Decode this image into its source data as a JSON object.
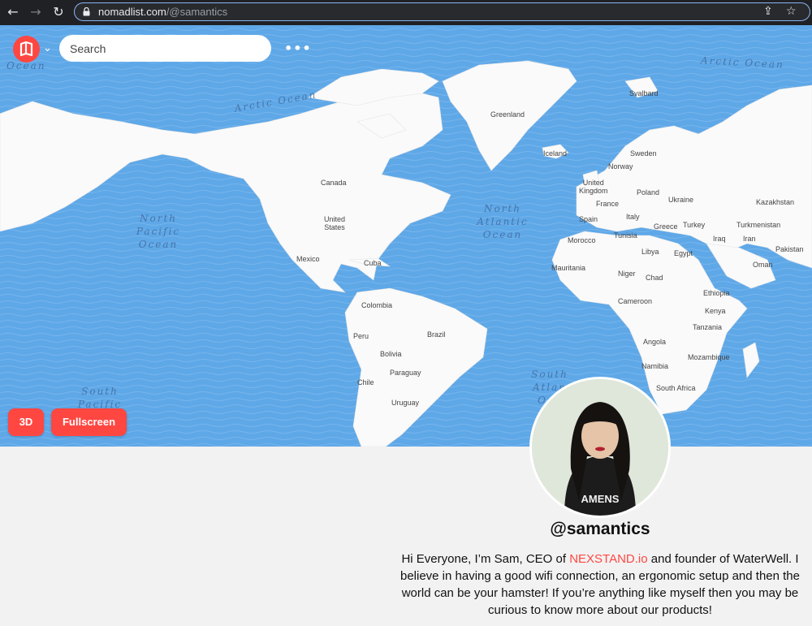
{
  "browser": {
    "url_host": "nomadlist.com",
    "url_path": "/@samantics",
    "icons": [
      "back-arrow-icon",
      "forward-arrow-icon",
      "reload-icon",
      "lock-icon",
      "share-icon",
      "star-icon"
    ]
  },
  "header": {
    "logo_icon": "nomad-list-logo",
    "search_placeholder": "Search",
    "more_icon": "more-dots-icon"
  },
  "map": {
    "oceans": {
      "arctic_left": "Arctic Ocean",
      "arctic_right": "Arctic Ocean",
      "arctic_top_left": "Ocean",
      "north_pacific": [
        "North",
        "Pacific",
        "Ocean"
      ],
      "north_atlantic": [
        "North",
        "Atlantic",
        "Ocean"
      ],
      "south_pacific": [
        "South",
        "Pacific"
      ],
      "south_atlantic": [
        "South",
        "Atlan",
        "Oce"
      ]
    },
    "countries": {
      "svalbard": "Svalbard",
      "greenland": "Greenland",
      "iceland": "Iceland",
      "sweden": "Sweden",
      "norway": "Norway",
      "uk": [
        "United",
        "Kingdom"
      ],
      "poland": "Poland",
      "france": "France",
      "ukraine": "Ukraine",
      "kazakhstan": "Kazakhstan",
      "canada": "Canada",
      "usa": [
        "United",
        "States"
      ],
      "spain": "Spain",
      "italy": "Italy",
      "turkey": "Turkey",
      "turkmenistan": "Turkmenistan",
      "morocco": "Morocco",
      "tunisia": "Tunisia",
      "iraq": "Iraq",
      "iran": "Iran",
      "greece": "Greece",
      "libya": "Libya",
      "egypt": "Egypt",
      "pakistan": "Pakistan",
      "mexico": "Mexico",
      "cuba": "Cuba",
      "oman": "Oman",
      "mauritania": "Mauritania",
      "niger": "Niger",
      "chad": "Chad",
      "ethiopia": "Ethiopia",
      "cameroon": "Cameroon",
      "kenya": "Kenya",
      "colombia": "Colombia",
      "tanzania": "Tanzania",
      "peru": "Peru",
      "brazil": "Brazil",
      "angola": "Angola",
      "bolivia": "Bolivia",
      "mozambique": "Mozambique",
      "paraguay": "Paraguay",
      "namibia": "Namibia",
      "chile": "Chile",
      "south_africa": "South Africa",
      "uruguay": "Uruguay"
    },
    "buttons": {
      "three_d": "3D",
      "fullscreen": "Fullscreen"
    },
    "colors": {
      "ocean": "#5fa8e8",
      "land": "#fafafa",
      "accent": "#ff4742"
    }
  },
  "profile": {
    "handle": "@samantics",
    "bio_before": "Hi Everyone, I’m Sam, CEO of ",
    "bio_link": "NEXSTAND.io",
    "bio_after": " and founder of WaterWell. I believe in having a good wifi connection, an ergonomic setup and then the world can be your hamster! If you’re anything like myself then you may be curious to know more about our products!",
    "avatar_shirt_text": "AMENS"
  }
}
